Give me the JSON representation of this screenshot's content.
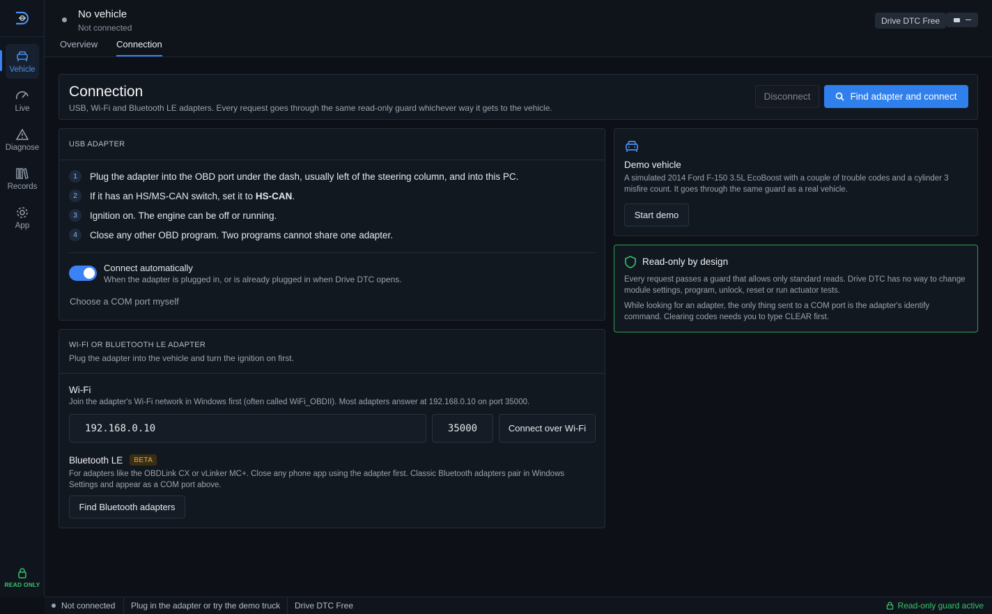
{
  "sidebar": {
    "items": [
      {
        "label": "Vehicle",
        "icon": "car-icon",
        "active": true
      },
      {
        "label": "Live",
        "icon": "gauge-icon"
      },
      {
        "label": "Diagnose",
        "icon": "warning-icon"
      },
      {
        "label": "Records",
        "icon": "books-icon"
      },
      {
        "label": "App",
        "icon": "gear-icon"
      }
    ],
    "readonly_label": "READ ONLY"
  },
  "header": {
    "vehicle_title": "No vehicle",
    "vehicle_status": "Not connected",
    "tabs": [
      {
        "label": "Overview"
      },
      {
        "label": "Connection",
        "active": true
      }
    ],
    "badge": "Drive DTC Free"
  },
  "connection": {
    "title": "Connection",
    "subtitle": "USB, Wi-Fi and Bluetooth LE adapters. Every request goes through the same read-only guard whichever way it gets to the vehicle.",
    "disconnect_label": "Disconnect",
    "find_label": "Find adapter and connect"
  },
  "usb": {
    "heading": "USB ADAPTER",
    "steps": [
      {
        "num": "1",
        "text": "Plug the adapter into the OBD port under the dash, usually left of the steering column, and into this PC."
      },
      {
        "num": "2",
        "text_before": "If it has an HS/MS-CAN switch, set it to ",
        "text_strong": "HS-CAN",
        "text_after": "."
      },
      {
        "num": "3",
        "text": "Ignition on. The engine can be off or running."
      },
      {
        "num": "4",
        "text": "Close any other OBD program. Two programs cannot share one adapter."
      }
    ],
    "auto_title": "Connect automatically",
    "auto_sub": "When the adapter is plugged in, or is already plugged in when Drive DTC opens.",
    "auto_enabled": true,
    "com_link": "Choose a COM port myself"
  },
  "wireless": {
    "heading": "WI-FI OR BLUETOOTH LE ADAPTER",
    "subtitle": "Plug the adapter into the vehicle and turn the ignition on first.",
    "wifi_title": "Wi-Fi",
    "wifi_sub": "Join the adapter's Wi-Fi network in Windows first (often called WiFi_OBDII). Most adapters answer at 192.168.0.10 on port 35000.",
    "ip_value": "192.168.0.10",
    "port_value": "35000",
    "wifi_button": "Connect over Wi-Fi",
    "ble_title": "Bluetooth LE",
    "ble_badge": "BETA",
    "ble_sub_line1": "For adapters like the OBDLink CX or vLinker MC+. Close any phone app using the adapter first. Classic Bluetooth adapters pair in Windows",
    "ble_sub_line2": "Settings and appear as a COM port above.",
    "ble_button": "Find Bluetooth adapters"
  },
  "demo": {
    "title": "Demo vehicle",
    "line1": "A simulated 2014 Ford F-150 3.5L EcoBoost with a couple of trouble codes and a cylinder 3",
    "line2": "misfire count. It goes through the same guard as a real vehicle.",
    "button": "Start demo"
  },
  "readonly_card": {
    "title": "Read-only by design",
    "p1_line1": "Every request passes a guard that allows only standard reads. Drive DTC has no way to change",
    "p1_line2": "module settings, program, unlock, reset or run actuator tests.",
    "p2_line1": "While looking for an adapter, the only thing sent to a COM port is the adapter's identify",
    "p2_line2": "command. Clearing codes needs you to type CLEAR first."
  },
  "statusbar": {
    "status": "Not connected",
    "hint": "Plug in the adapter or try the demo truck",
    "edition": "Drive DTC Free",
    "guard": "Read-only guard active"
  },
  "colors": {
    "accent": "#3b82f6",
    "success": "#39c56b",
    "beta": "#e0b04a"
  }
}
